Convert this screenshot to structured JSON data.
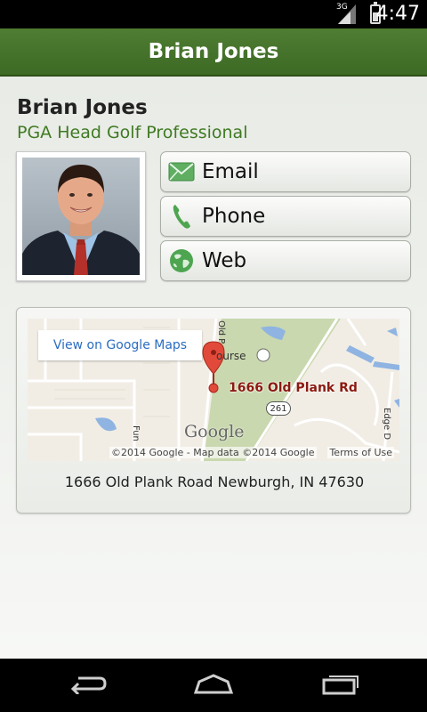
{
  "status_bar": {
    "network": "3G",
    "battery_level": 0.55,
    "time": "4:47"
  },
  "action_bar": {
    "title": "Brian Jones"
  },
  "profile": {
    "name": "Brian Jones",
    "role": "PGA Head Golf Professional",
    "photo_icon": "person-photo"
  },
  "actions": [
    {
      "label": "Email",
      "icon": "envelope-icon"
    },
    {
      "label": "Phone",
      "icon": "phone-icon"
    },
    {
      "label": "Web",
      "icon": "globe-icon"
    }
  ],
  "map": {
    "link_label": "View on Google Maps",
    "pin_label": "1666 Old Plank Rd",
    "road_number": "261",
    "logo": "Google",
    "course_label": "ourse",
    "street_old": "Old P",
    "street_edge": "Edge D",
    "street_fun": "Fun",
    "copyright": "©2014 Google - Map data ©2014 Google",
    "terms": "Terms of Use"
  },
  "address": "1666 Old Plank Road Newburgh, IN 47630",
  "colors": {
    "action_bar": "#46752b",
    "accent_text": "#3f7a22",
    "link": "#2b6dc0",
    "pin": "#d93a2b"
  },
  "nav": {
    "back_icon": "back-icon",
    "home_icon": "home-icon",
    "recents_icon": "recents-icon"
  }
}
